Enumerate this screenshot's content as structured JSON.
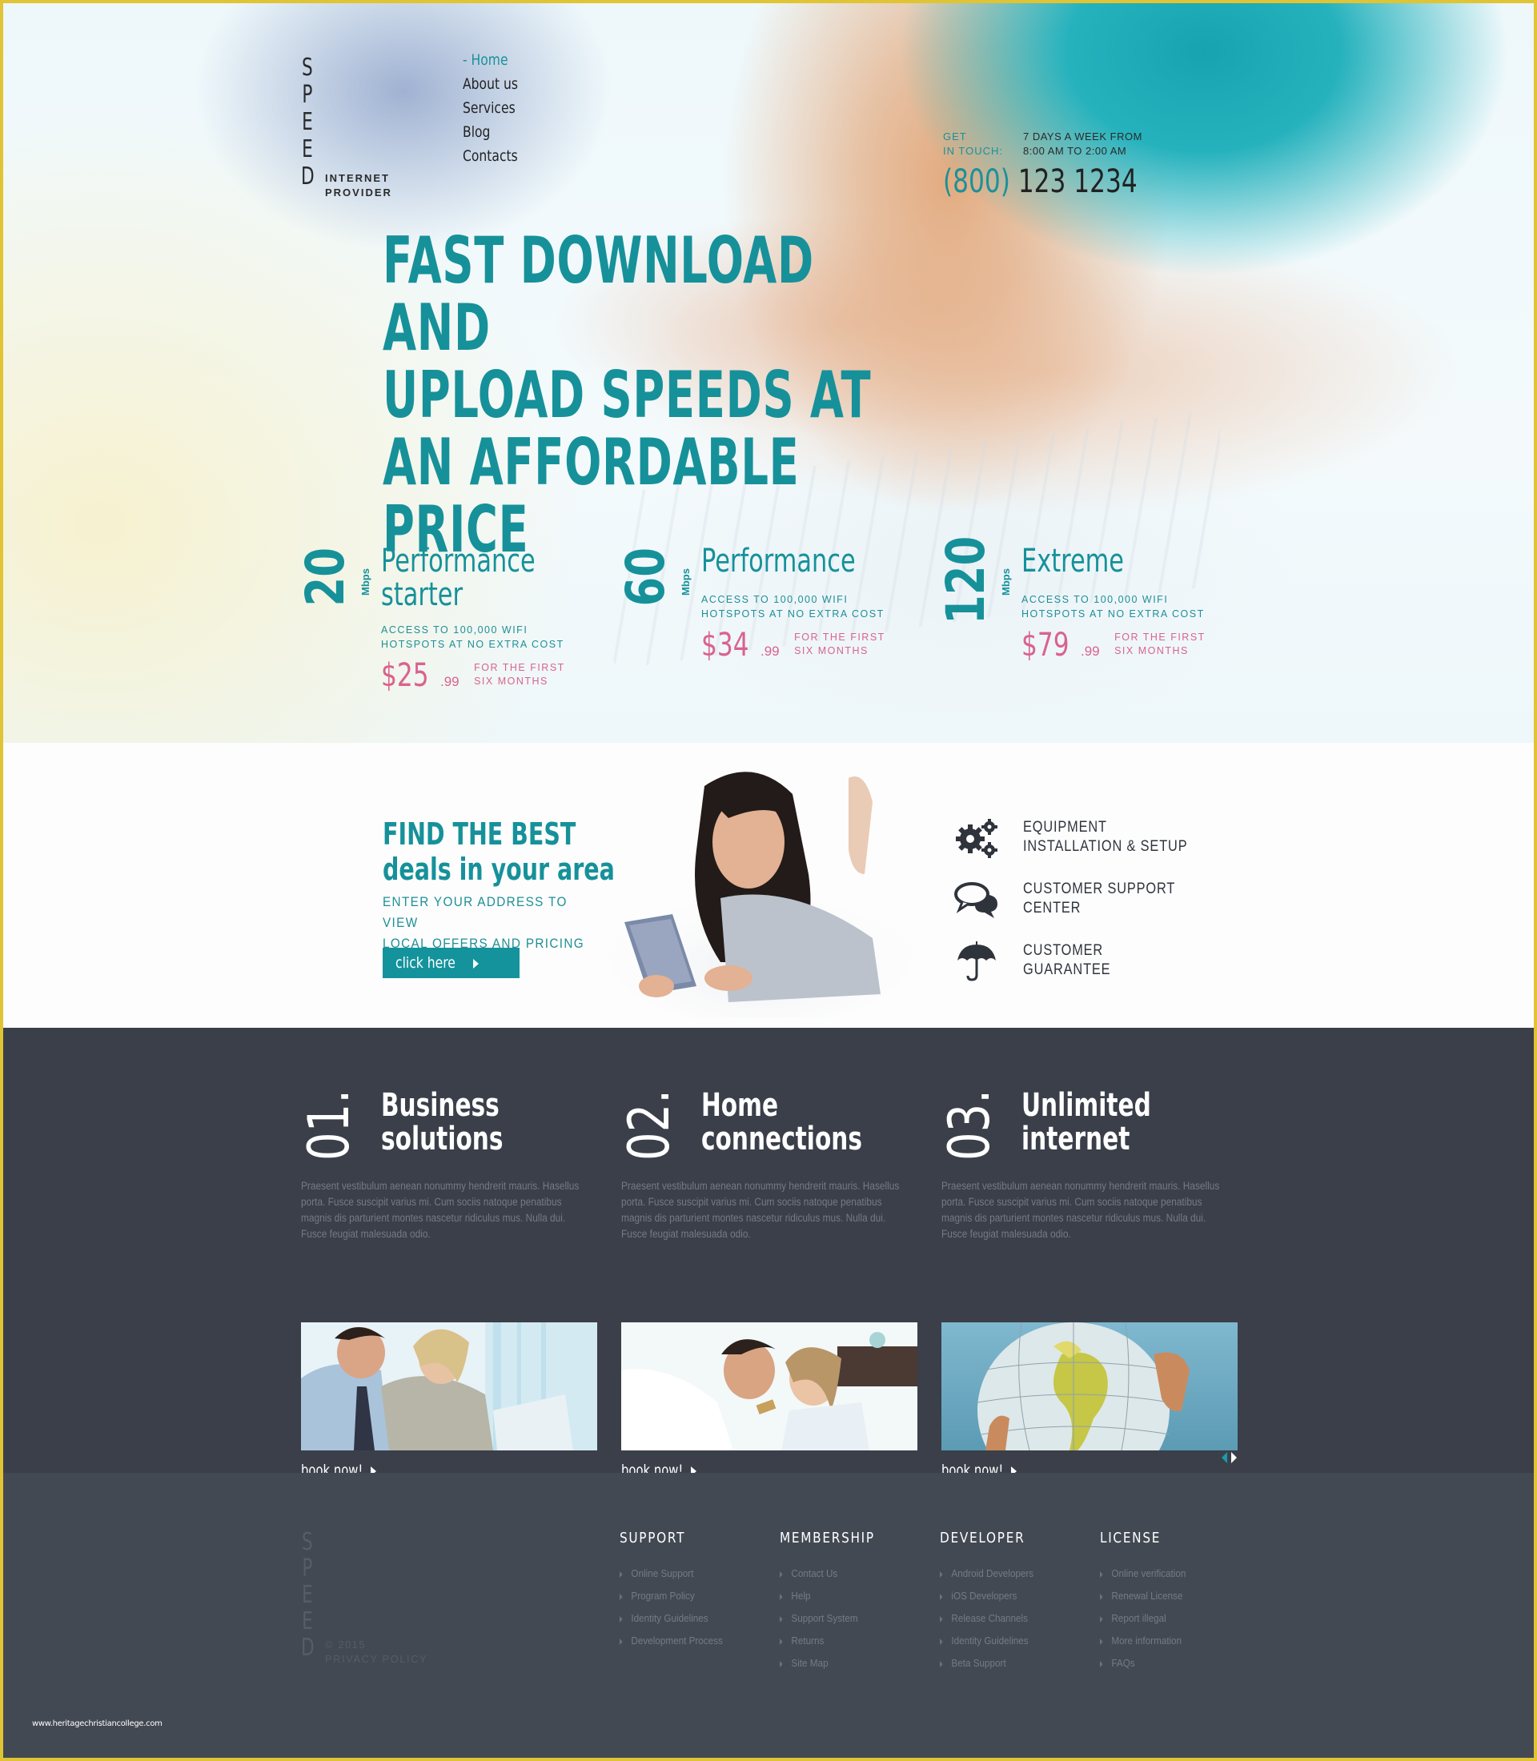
{
  "brand": {
    "logo_word": "SPEED",
    "tagline_line1": "INTERNET",
    "tagline_line2": "PROVIDER",
    "accent_color": "#16919a",
    "price_color": "#d9638e",
    "border_color": "#e0c433"
  },
  "nav": {
    "items": [
      {
        "label": "Home",
        "active": true
      },
      {
        "label": "About us"
      },
      {
        "label": "Services"
      },
      {
        "label": "Blog"
      },
      {
        "label": "Contacts"
      }
    ],
    "active_marker": "-"
  },
  "contact": {
    "label_line1": "GET",
    "label_line2": "IN TOUCH:",
    "hours_line1": "7 DAYS A WEEK FROM",
    "hours_line2": "8:00 AM TO 2:00 AM",
    "phone_code": "(800)",
    "phone_number": "123 1234"
  },
  "hero": {
    "headline_lines": [
      "FAST DOWNLOAD AND",
      "UPLOAD SPEEDS AT",
      "AN AFFORDABLE",
      "PRICE"
    ]
  },
  "plans": [
    {
      "speed": "20",
      "unit": "Mbps",
      "name_line1": "Performance",
      "name_line2": "starter",
      "desc_line1": "ACCESS TO 100,000 WIFI",
      "desc_line2": "HOTSPOTS AT NO EXTRA COST",
      "price": "$25",
      "cents": ".99",
      "note_line1": "FOR THE FIRST",
      "note_line2": "SIX MONTHS"
    },
    {
      "speed": "60",
      "unit": "Mbps",
      "name_line1": "Performance",
      "name_line2": "",
      "desc_line1": "ACCESS TO 100,000 WIFI",
      "desc_line2": "HOTSPOTS AT NO EXTRA COST",
      "price": "$34",
      "cents": ".99",
      "note_line1": "FOR THE FIRST",
      "note_line2": "SIX MONTHS"
    },
    {
      "speed": "120",
      "unit": "Mbps",
      "name_line1": "Extreme",
      "name_line2": "",
      "desc_line1": "ACCESS TO 100,000 WIFI",
      "desc_line2": "HOTSPOTS AT NO EXTRA COST",
      "price": "$79",
      "cents": ".99",
      "note_line1": "FOR THE FIRST",
      "note_line2": "SIX MONTHS"
    }
  ],
  "deals": {
    "title_line1": "FIND THE BEST",
    "title_line2": "deals in your area",
    "sub_line1": "ENTER YOUR ADDRESS TO VIEW",
    "sub_line2": "LOCAL OFFERS AND PRICING",
    "button_label": "click here"
  },
  "features": [
    {
      "icon": "gears-icon",
      "line1": "EQUIPMENT",
      "line2": "INSTALLATION & SETUP"
    },
    {
      "icon": "chat-bubbles-icon",
      "line1": "CUSTOMER SUPPORT",
      "line2": "CENTER"
    },
    {
      "icon": "umbrella-icon",
      "line1": "CUSTOMER",
      "line2": "GUARANTEE"
    }
  ],
  "services": [
    {
      "number": "01.",
      "title_line1": "Business",
      "title_line2": "solutions",
      "body": "Praesent vestibulum aenean nonummy hendrerit mauris. Hasellus porta. Fusce suscipit varius mi. Cum sociis natoque penatibus magnis dis parturient montes nascetur ridiculus mus. Nulla dui. Fusce feugiat malesuada odio.",
      "image": "business-people-laptop-photo",
      "cta": "book now!"
    },
    {
      "number": "02.",
      "title_line1": "Home",
      "title_line2": "connections",
      "body": "Praesent vestibulum aenean nonummy hendrerit mauris. Hasellus porta. Fusce suscipit varius mi. Cum sociis natoque penatibus magnis dis parturient montes nascetur ridiculus mus. Nulla dui. Fusce feugiat malesuada odio.",
      "image": "couple-shopping-online-photo",
      "cta": "book now!"
    },
    {
      "number": "03.",
      "title_line1": "Unlimited",
      "title_line2": "internet",
      "body": "Praesent vestibulum aenean nonummy hendrerit mauris. Hasellus porta. Fusce suscipit varius mi. Cum sociis natoque penatibus magnis dis parturient montes nascetur ridiculus mus. Nulla dui. Fusce feugiat malesuada odio.",
      "image": "hands-holding-globe-photo",
      "cta": "book now!"
    }
  ],
  "footer": {
    "logo_word": "SPEED",
    "copyright": "© 2015",
    "privacy": "PRIVACY POLICY",
    "columns": [
      {
        "heading": "SUPPORT",
        "links": [
          "Online Support",
          "Program Policy",
          "Identity Guidelines",
          "Development Process"
        ]
      },
      {
        "heading": "MEMBERSHIP",
        "links": [
          "Contact Us",
          "Help",
          "Support System",
          "Returns",
          "Site Map"
        ]
      },
      {
        "heading": "DEVELOPER",
        "links": [
          "Android Developers",
          "iOS Developers",
          "Release Channels",
          "Identity Guidelines",
          "Beta Support"
        ]
      },
      {
        "heading": "LICENSE",
        "links": [
          "Online verification",
          "Renewal License",
          "Report illegal",
          "More information",
          "FAQs"
        ]
      }
    ]
  },
  "watermark": "www.heritagechristiancollege.com"
}
